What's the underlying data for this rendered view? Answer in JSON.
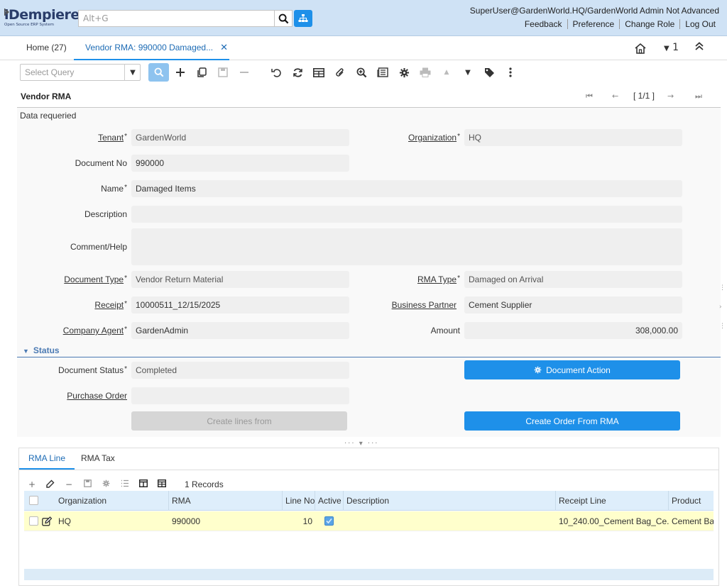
{
  "app": {
    "logo_title": "iDempiere",
    "logo_subtitle": "Open Source ERP System",
    "search_placeholder": "Alt+G",
    "user_info": "SuperUser@GardenWorld.HQ/GardenWorld Admin Not Advanced",
    "links": [
      "Feedback",
      "Preference",
      "Change Role",
      "Log Out"
    ]
  },
  "tabs": {
    "home_label": "Home (27)",
    "active_label": "Vendor RMA: 990000 Damaged...",
    "window_count": "1"
  },
  "toolbar": {
    "query_placeholder": "Select Query"
  },
  "window": {
    "title": "Vendor RMA",
    "record_counter": "[ 1/1 ]",
    "message": "Data requeried"
  },
  "form": {
    "tenant_label": "Tenant",
    "tenant_value": "GardenWorld",
    "organization_label": "Organization",
    "organization_value": "HQ",
    "document_no_label": "Document No",
    "document_no_value": "990000",
    "name_label": "Name",
    "name_value": "Damaged Items",
    "description_label": "Description",
    "description_value": "",
    "comment_label": "Comment/Help",
    "comment_value": "",
    "document_type_label": "Document Type",
    "document_type_value": "Vendor Return Material",
    "rma_type_label": "RMA Type",
    "rma_type_value": "Damaged on Arrival",
    "receipt_label": "Receipt",
    "receipt_value": "10000511_12/15/2025",
    "business_partner_label": "Business Partner",
    "business_partner_value": "Cement Supplier",
    "company_agent_label": "Company Agent",
    "company_agent_value": "GardenAdmin",
    "amount_label": "Amount",
    "amount_value": "308,000.00"
  },
  "status_section": {
    "title": "Status",
    "document_status_label": "Document Status",
    "document_status_value": "Completed",
    "purchase_order_label": "Purchase Order",
    "purchase_order_value": "",
    "document_action_button": "Document Action",
    "create_lines_button": "Create lines from",
    "create_order_button": "Create Order From RMA"
  },
  "detail": {
    "tabs": [
      "RMA Line",
      "RMA Tax"
    ],
    "records_label": "1 Records",
    "columns": [
      "Organization",
      "RMA",
      "Line No",
      "Active",
      "Description",
      "Receipt Line",
      "Product"
    ],
    "rows": [
      {
        "organization": "HQ",
        "rma": "990000",
        "line_no": "10",
        "active": true,
        "description": "",
        "receipt_line": "10_240.00_Cement Bag_Ce...",
        "product": "Cement Bag"
      }
    ]
  },
  "colors": {
    "header_bg": "#cfe2f5",
    "accent": "#1e90e9",
    "selected_row": "#ffffcc"
  }
}
